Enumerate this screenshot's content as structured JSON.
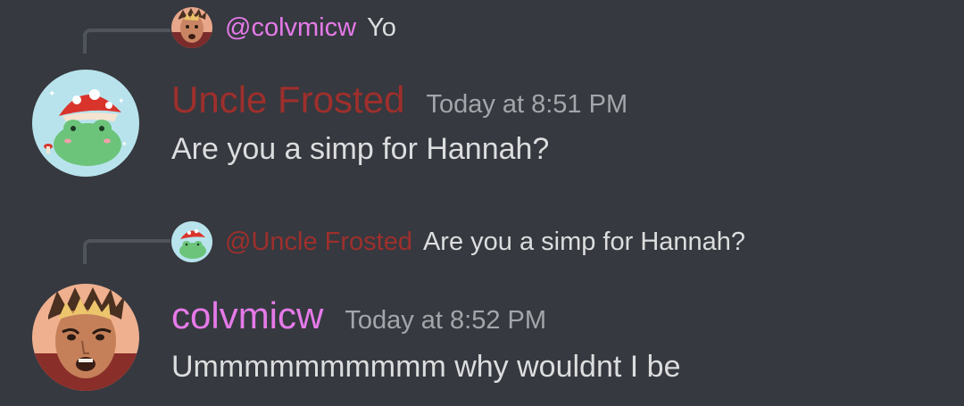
{
  "messages": [
    {
      "reply": {
        "mention": "@colvmicw",
        "text": "Yo"
      },
      "author": "Uncle Frosted",
      "timestamp": "Today at 8:51 PM",
      "content": "Are you a simp for Hannah?"
    },
    {
      "reply": {
        "mention": "@Uncle Frosted",
        "text": "Are you a simp for Hannah?"
      },
      "author": "colvmicw",
      "timestamp": "Today at 8:52 PM",
      "content": "Ummmmmmmmmm why wouldnt I be"
    }
  ],
  "colors": {
    "background": "#36393f",
    "uncle_frosted_name": "#9e2f2c",
    "colvmicw_name": "#e57ae9",
    "message_text": "#dcddde",
    "timestamp": "#a3a6aa",
    "reply_spine": "#4f545c"
  },
  "avatars": {
    "uncle_frosted": "frog-mushroom-avatar",
    "colvmicw": "person-portrait-avatar"
  }
}
